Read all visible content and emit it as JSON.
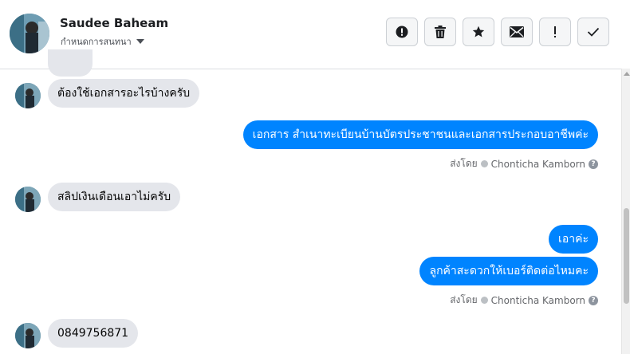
{
  "header": {
    "contact_name": "Saudee Baheam",
    "subtitle": "กำหนดการสนทนา"
  },
  "toolbar": [
    {
      "icon": "alert-circle-icon"
    },
    {
      "icon": "trash-icon"
    },
    {
      "icon": "star-icon"
    },
    {
      "icon": "envelope-icon"
    },
    {
      "icon": "exclamation-icon"
    },
    {
      "icon": "checkmark-icon"
    }
  ],
  "messages": [
    {
      "direction": "in",
      "text": "ต้องใช้เอกสารอะไรบ้างครับ"
    },
    {
      "direction": "out",
      "text": "เอกสาร สำเนาทะเบียนบ้านบัตรประชาชนและเอกสารประกอบอาชีพค่ะ"
    },
    {
      "direction": "meta",
      "prefix": "ส่งโดย",
      "sender": "Chonticha Kamborn"
    },
    {
      "direction": "in",
      "text": "สลิปเงินเดือนเอาไม่ครับ"
    },
    {
      "direction": "out",
      "text": "เอาค่ะ"
    },
    {
      "direction": "out",
      "text": "ลูกค้าสะดวกให้เบอร์ติดต่อไหมคะ"
    },
    {
      "direction": "meta",
      "prefix": "ส่งโดย",
      "sender": "Chonticha Kamborn"
    },
    {
      "direction": "in",
      "text": "0849756871"
    }
  ],
  "colors": {
    "outgoing_bubble": "#0084ff",
    "incoming_bubble": "#e4e6eb",
    "meta_text": "#65676b"
  }
}
